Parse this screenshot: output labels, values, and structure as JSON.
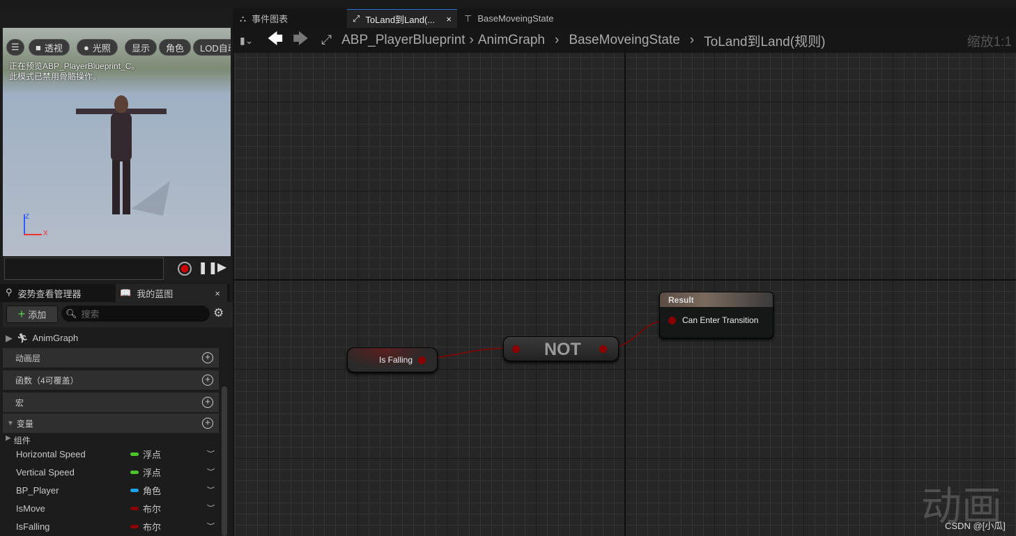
{
  "viewport": {
    "buttons": [
      "透视",
      "光照",
      "显示",
      "角色",
      "LOD自动"
    ],
    "note": [
      "正在预览ABP_PlayerBlueprint_C。",
      "此模式已禁用骨骼操作。"
    ],
    "axis": {
      "z": "Z",
      "x": "X"
    }
  },
  "panel": {
    "tabs": [
      "姿势查看管理器",
      "我的蓝图"
    ],
    "add_label": "添加",
    "search_placeholder": "搜索",
    "tree_root": "AnimGraph",
    "sections": [
      "动画层",
      "函数（4可覆盖）",
      "宏",
      "变量"
    ],
    "components": "组件",
    "variables": [
      {
        "name": "Horizontal Speed",
        "type": "浮点",
        "color": "#4cc42a"
      },
      {
        "name": "Vertical Speed",
        "type": "浮点",
        "color": "#4cc42a"
      },
      {
        "name": "BP_Player",
        "type": "角色",
        "color": "#1aa3e8"
      },
      {
        "name": "IsMove",
        "type": "布尔",
        "color": "#8c0000"
      },
      {
        "name": "IsFalling",
        "type": "布尔",
        "color": "#8c0000"
      }
    ]
  },
  "editor": {
    "tabs": [
      "事件图表",
      "ToLand到Land(...",
      "BaseMoveingState"
    ],
    "breadcrumb": [
      "ABP_PlayerBlueprint",
      "AnimGraph",
      "BaseMoveingState",
      "ToLand到Land(规则)"
    ],
    "zoom": "缩放1:1",
    "nodes": {
      "getter": "Is Falling",
      "not": "NOT",
      "result_title": "Result",
      "result_pin": "Can Enter Transition"
    },
    "watermark": "动画",
    "credit": "CSDN @[小瓜]"
  }
}
